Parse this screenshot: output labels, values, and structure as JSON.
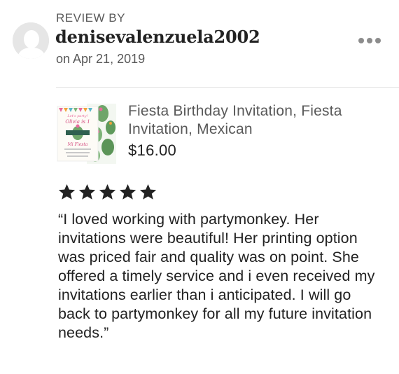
{
  "review": {
    "header_label": "REVIEW BY",
    "username": "denisevalenzuela2002",
    "date": "on Apr 21, 2019",
    "rating": 5,
    "text": "“I loved working with partymonkey. Her invitations were beautiful! Her printing option was priced fair and quality was on point. She offered a timely service and i even received my invitations earlier than i anticipated. I will go back to partymonkey for all my future invitation needs.”"
  },
  "product": {
    "title": "Fiesta Birthday Invitation, Fiesta Invitation, Mexican",
    "price": "$16.00",
    "thumbnail_text": {
      "greeting": "Let's party!",
      "name_line": "Olivia is 1",
      "script_line": "Mi Fiesta"
    }
  },
  "icons": {
    "avatar": "default-user-avatar",
    "more": "more-options-icon",
    "star": "star-icon"
  },
  "colors": {
    "text_primary": "#222222",
    "text_secondary": "#595959",
    "divider": "#e1e1e1",
    "star": "#222222"
  }
}
